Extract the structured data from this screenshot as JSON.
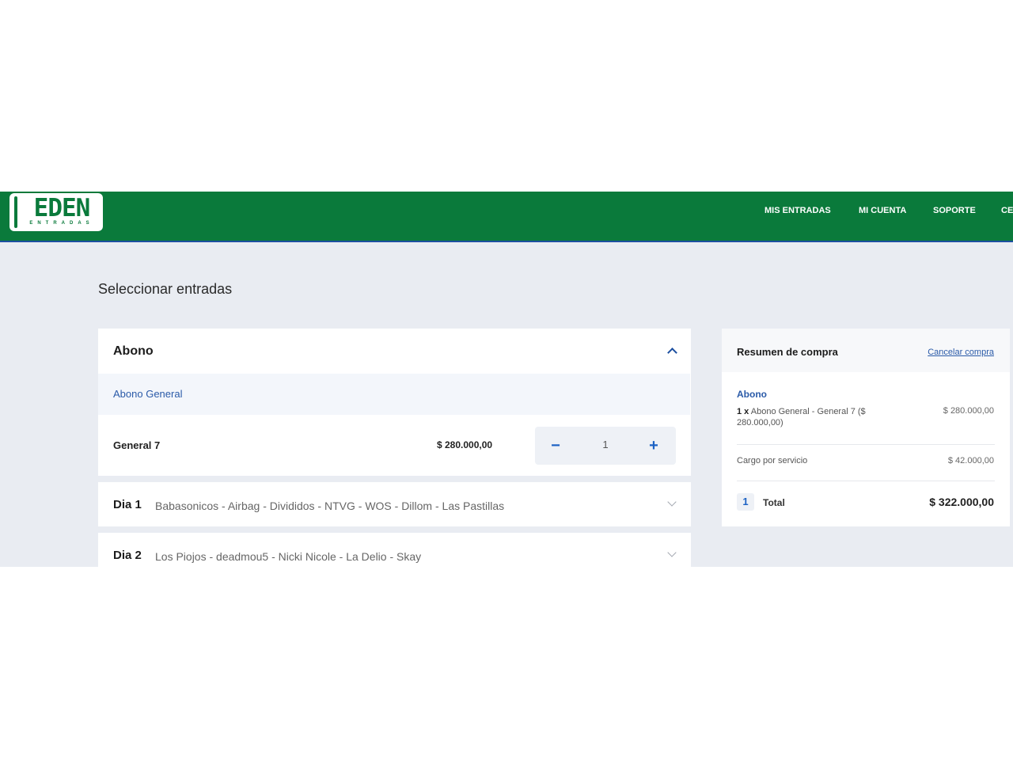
{
  "header": {
    "logo_text": "EDEN",
    "logo_subtext": "ENTRADAS",
    "nav": [
      "MIS ENTRADAS",
      "MI CUENTA",
      "SOPORTE",
      "CE"
    ]
  },
  "page_title": "Seleccionar entradas",
  "abono": {
    "title": "Abono",
    "category": "Abono General",
    "ticket_name": "General 7",
    "ticket_price": "$ 280.000,00",
    "quantity": "1",
    "minus": "−",
    "plus": "+"
  },
  "days": [
    {
      "label": "Dia 1",
      "lineup": "Babasonicos - Airbag - Divididos - NTVG - WOS - Dillom - Las Pastillas"
    },
    {
      "label": "Dia 2",
      "lineup": "Los Piojos - deadmou5 - Nicki Nicole - La Delio - Skay"
    }
  ],
  "summary": {
    "title": "Resumen de compra",
    "cancel": "Cancelar compra",
    "section": "Abono",
    "item_qty": "1 x",
    "item_desc": "Abono General - General 7 ($ 280.000,00)",
    "item_amount": "$ 280.000,00",
    "service_label": "Cargo por servicio",
    "service_amount": "$ 42.000,00",
    "count": "1",
    "total_label": "Total",
    "total_amount": "$ 322.000,00"
  },
  "colors": {
    "brand": "#0a7a3b",
    "accent": "#1c62c4",
    "link": "#2a5aa8"
  }
}
